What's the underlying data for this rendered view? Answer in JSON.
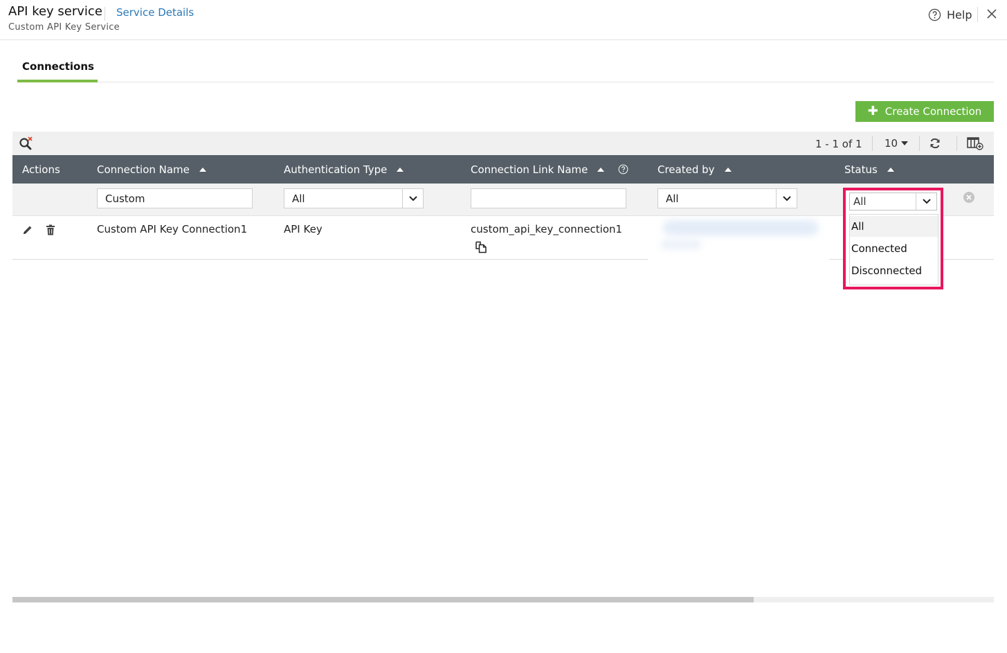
{
  "header": {
    "title": "API key service",
    "service_details_link": "Service Details",
    "subtitle": "Custom API Key Service",
    "help_label": "Help"
  },
  "tabs": [
    {
      "label": "Connections",
      "active": true
    }
  ],
  "actions": {
    "create_connection_label": "Create Connection"
  },
  "toolbar": {
    "pagination_text": "1 - 1 of 1",
    "per_page": "10"
  },
  "table": {
    "columns": [
      {
        "label": "Actions"
      },
      {
        "label": "Connection Name"
      },
      {
        "label": "Authentication Type"
      },
      {
        "label": "Connection Link Name"
      },
      {
        "label": "Created by"
      },
      {
        "label": "Status"
      }
    ],
    "filters": {
      "connection_name": "Custom",
      "authentication_type": "All",
      "connection_link_name": "",
      "created_by": "All",
      "status": "All"
    },
    "rows": [
      {
        "connection_name": "Custom API Key Connection1",
        "authentication_type": "API Key",
        "connection_link_name": "custom_api_key_connection1"
      }
    ]
  },
  "status_dropdown": {
    "selected": "All",
    "options": [
      "All",
      "Connected",
      "Disconnected"
    ]
  },
  "colors": {
    "accent_green": "#6ab843",
    "tab_underline": "#7dbb45",
    "header_bg": "#565f67",
    "highlight_border": "#e8175d",
    "link_blue": "#2a7ab8"
  }
}
